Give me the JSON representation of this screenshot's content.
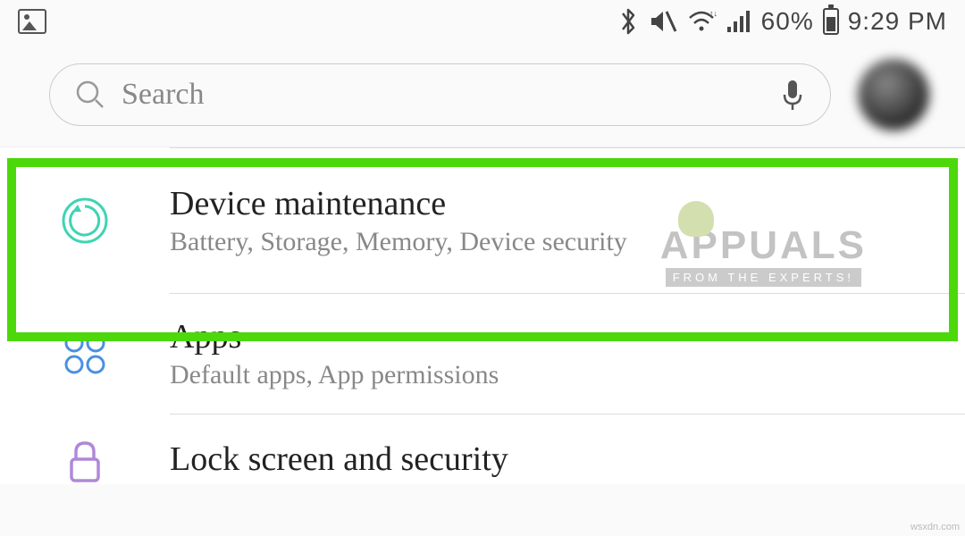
{
  "statusBar": {
    "batteryPercent": "60%",
    "time": "9:29 PM"
  },
  "search": {
    "placeholder": "Search"
  },
  "settings": {
    "items": [
      {
        "title": "Device maintenance",
        "subtitle": "Battery, Storage, Memory, Device security"
      },
      {
        "title": "Apps",
        "subtitle": "Default apps, App permissions"
      },
      {
        "title": "Lock screen and security",
        "subtitle": ""
      }
    ]
  },
  "watermark": {
    "title": "APPUALS",
    "subtitle": "FROM THE EXPERTS!"
  },
  "credit": "wsxdn.com"
}
